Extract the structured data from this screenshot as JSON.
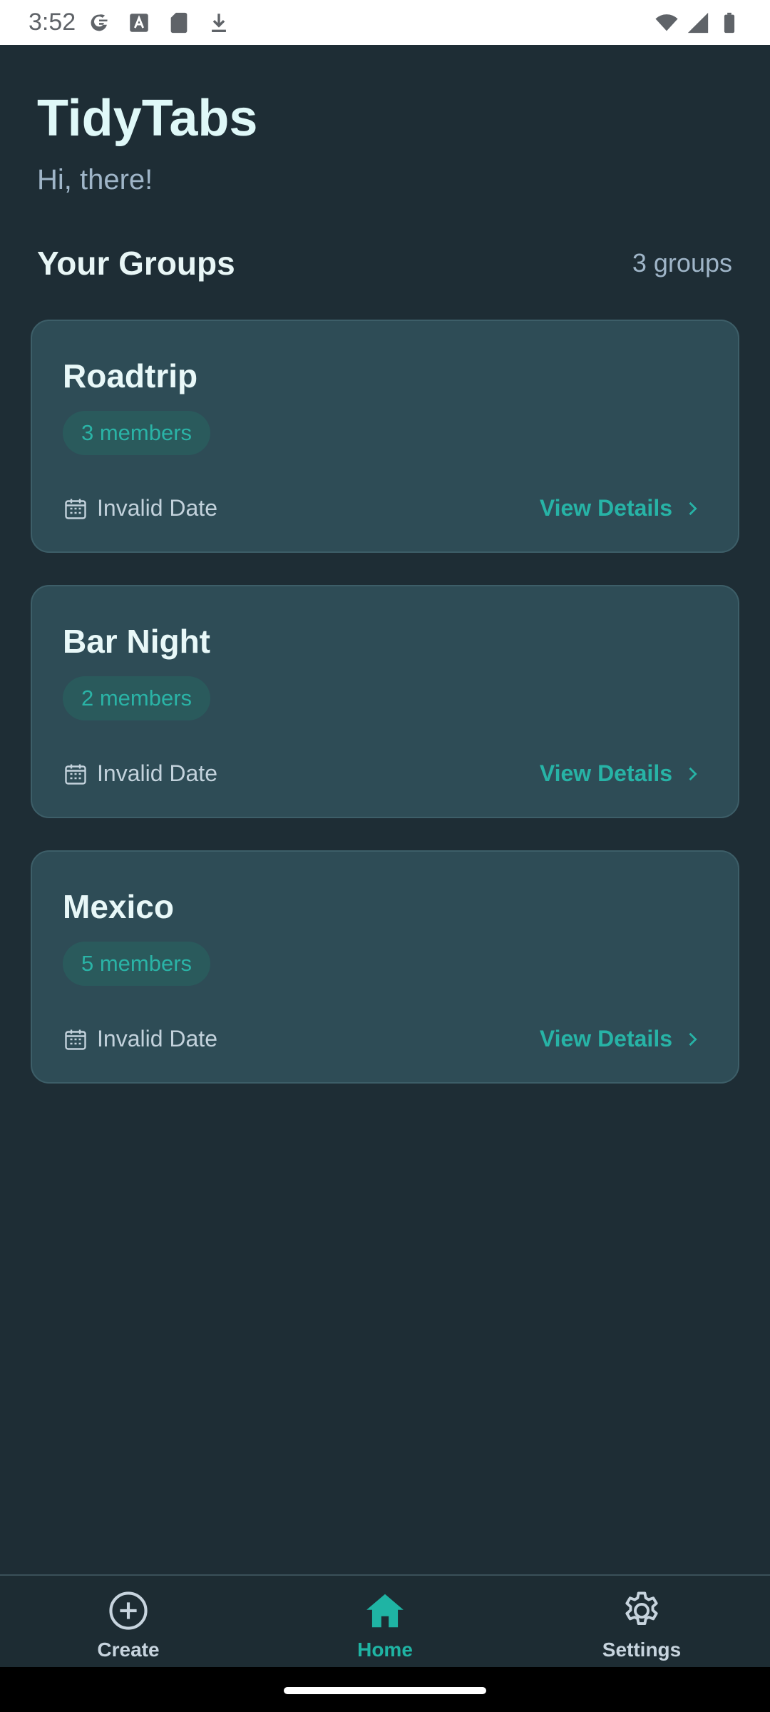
{
  "status_bar": {
    "time": "3:52",
    "left_icons": [
      "google-icon",
      "font-icon",
      "sd-card-icon",
      "download-icon"
    ],
    "right_icons": [
      "wifi-icon",
      "signal-icon",
      "battery-icon"
    ]
  },
  "header": {
    "title": "TidyTabs",
    "greeting": "Hi, there!"
  },
  "groups_section": {
    "title": "Your Groups",
    "count_label": "3 groups"
  },
  "groups": [
    {
      "name": "Roadtrip",
      "members": "3 members",
      "date": "Invalid Date",
      "action": "View Details"
    },
    {
      "name": "Bar Night",
      "members": "2 members",
      "date": "Invalid Date",
      "action": "View Details"
    },
    {
      "name": "Mexico",
      "members": "5 members",
      "date": "Invalid Date",
      "action": "View Details"
    }
  ],
  "bottom_nav": [
    {
      "label": "Create",
      "icon": "plus-circle-icon",
      "active": false
    },
    {
      "label": "Home",
      "icon": "home-icon",
      "active": true
    },
    {
      "label": "Settings",
      "icon": "gear-icon",
      "active": false
    }
  ],
  "colors": {
    "background": "#1e2d35",
    "card": "#2e4c56",
    "accent": "#1fb4a4"
  }
}
